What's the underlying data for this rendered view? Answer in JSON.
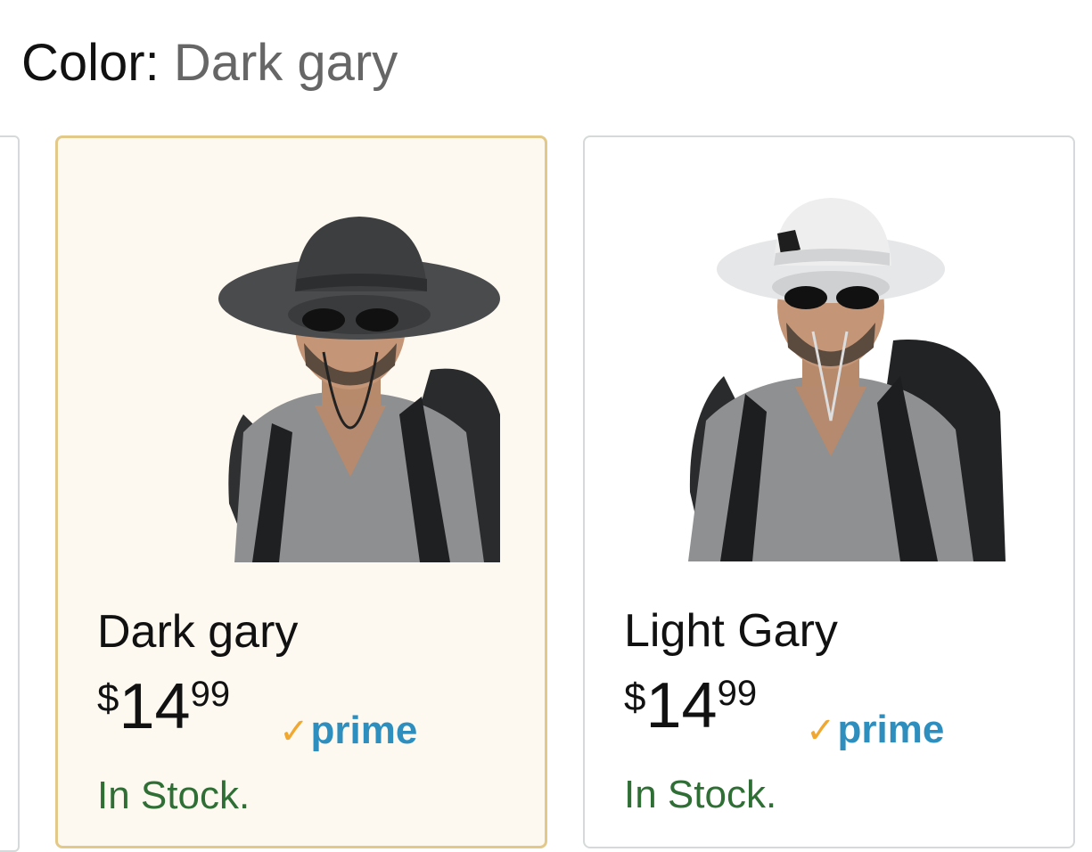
{
  "color_selector": {
    "label": "Color:",
    "selected_value": "Dark gary"
  },
  "options": [
    {
      "name": "Dark gary",
      "price_currency": "$",
      "price_whole": "14",
      "price_fraction": "99",
      "prime_label": "prime",
      "availability": "In Stock.",
      "selected": true,
      "hat_color": "#4a4b4c"
    },
    {
      "name": "Light Gary",
      "price_currency": "$",
      "price_whole": "14",
      "price_fraction": "99",
      "prime_label": "prime",
      "availability": "In Stock.",
      "selected": false,
      "hat_color": "#e6e7e8"
    }
  ],
  "colors": {
    "selected_border": "#e2c98a",
    "selected_background": "#fdf8f0",
    "prime_blue": "#2e8fbf",
    "prime_check": "#f0a830",
    "in_stock_green": "#2f6f35"
  }
}
